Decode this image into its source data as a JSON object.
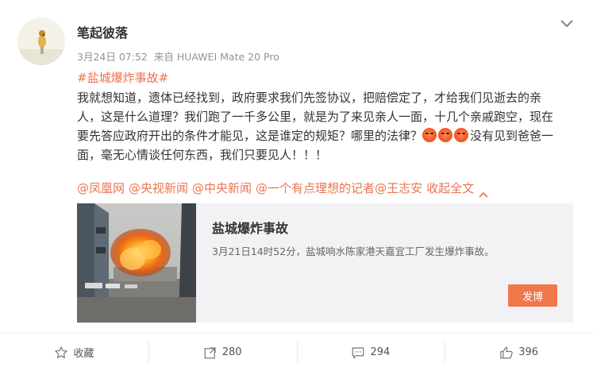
{
  "post": {
    "username": "笔起彼落",
    "date": "3月24日 07:52",
    "source": "来自 HUAWEI Mate 20 Pro",
    "hashtag": "#盐城爆炸事故#",
    "text": "我就想知道，遗体已经找到，政府要求我们先签协议，把赔偿定了，才给我们见逝去的亲人，这是什么道理？我们跑了一千多公里，就是为了来见亲人一面，十几个亲戚跑空，现在要先答应政府开出的条件才能见，这是谁定的规矩？哪里的法律？",
    "text_after_emoji": "没有见到爸爸一面，毫无心情谈任何东西，我们只要见人！！！",
    "emoji_icon": "angry-face-icon",
    "mentions": [
      "@凤凰网",
      "@央视新闻",
      "@中央新闻",
      "@一个有点理想的记者",
      "@王志安"
    ],
    "collapse_label": "收起全文"
  },
  "card": {
    "title": "盐城爆炸事故",
    "description": "3月21日14时52分，盐城响水陈家港天嘉宜工厂发生爆炸事故。",
    "button_label": "发博"
  },
  "toolbar": {
    "favorite_label": "收藏",
    "repost_count": "280",
    "comment_count": "294",
    "like_count": "396"
  },
  "colors": {
    "accent": "#eb7350",
    "button": "#f0774a",
    "card_bg": "#f2f2f5"
  }
}
